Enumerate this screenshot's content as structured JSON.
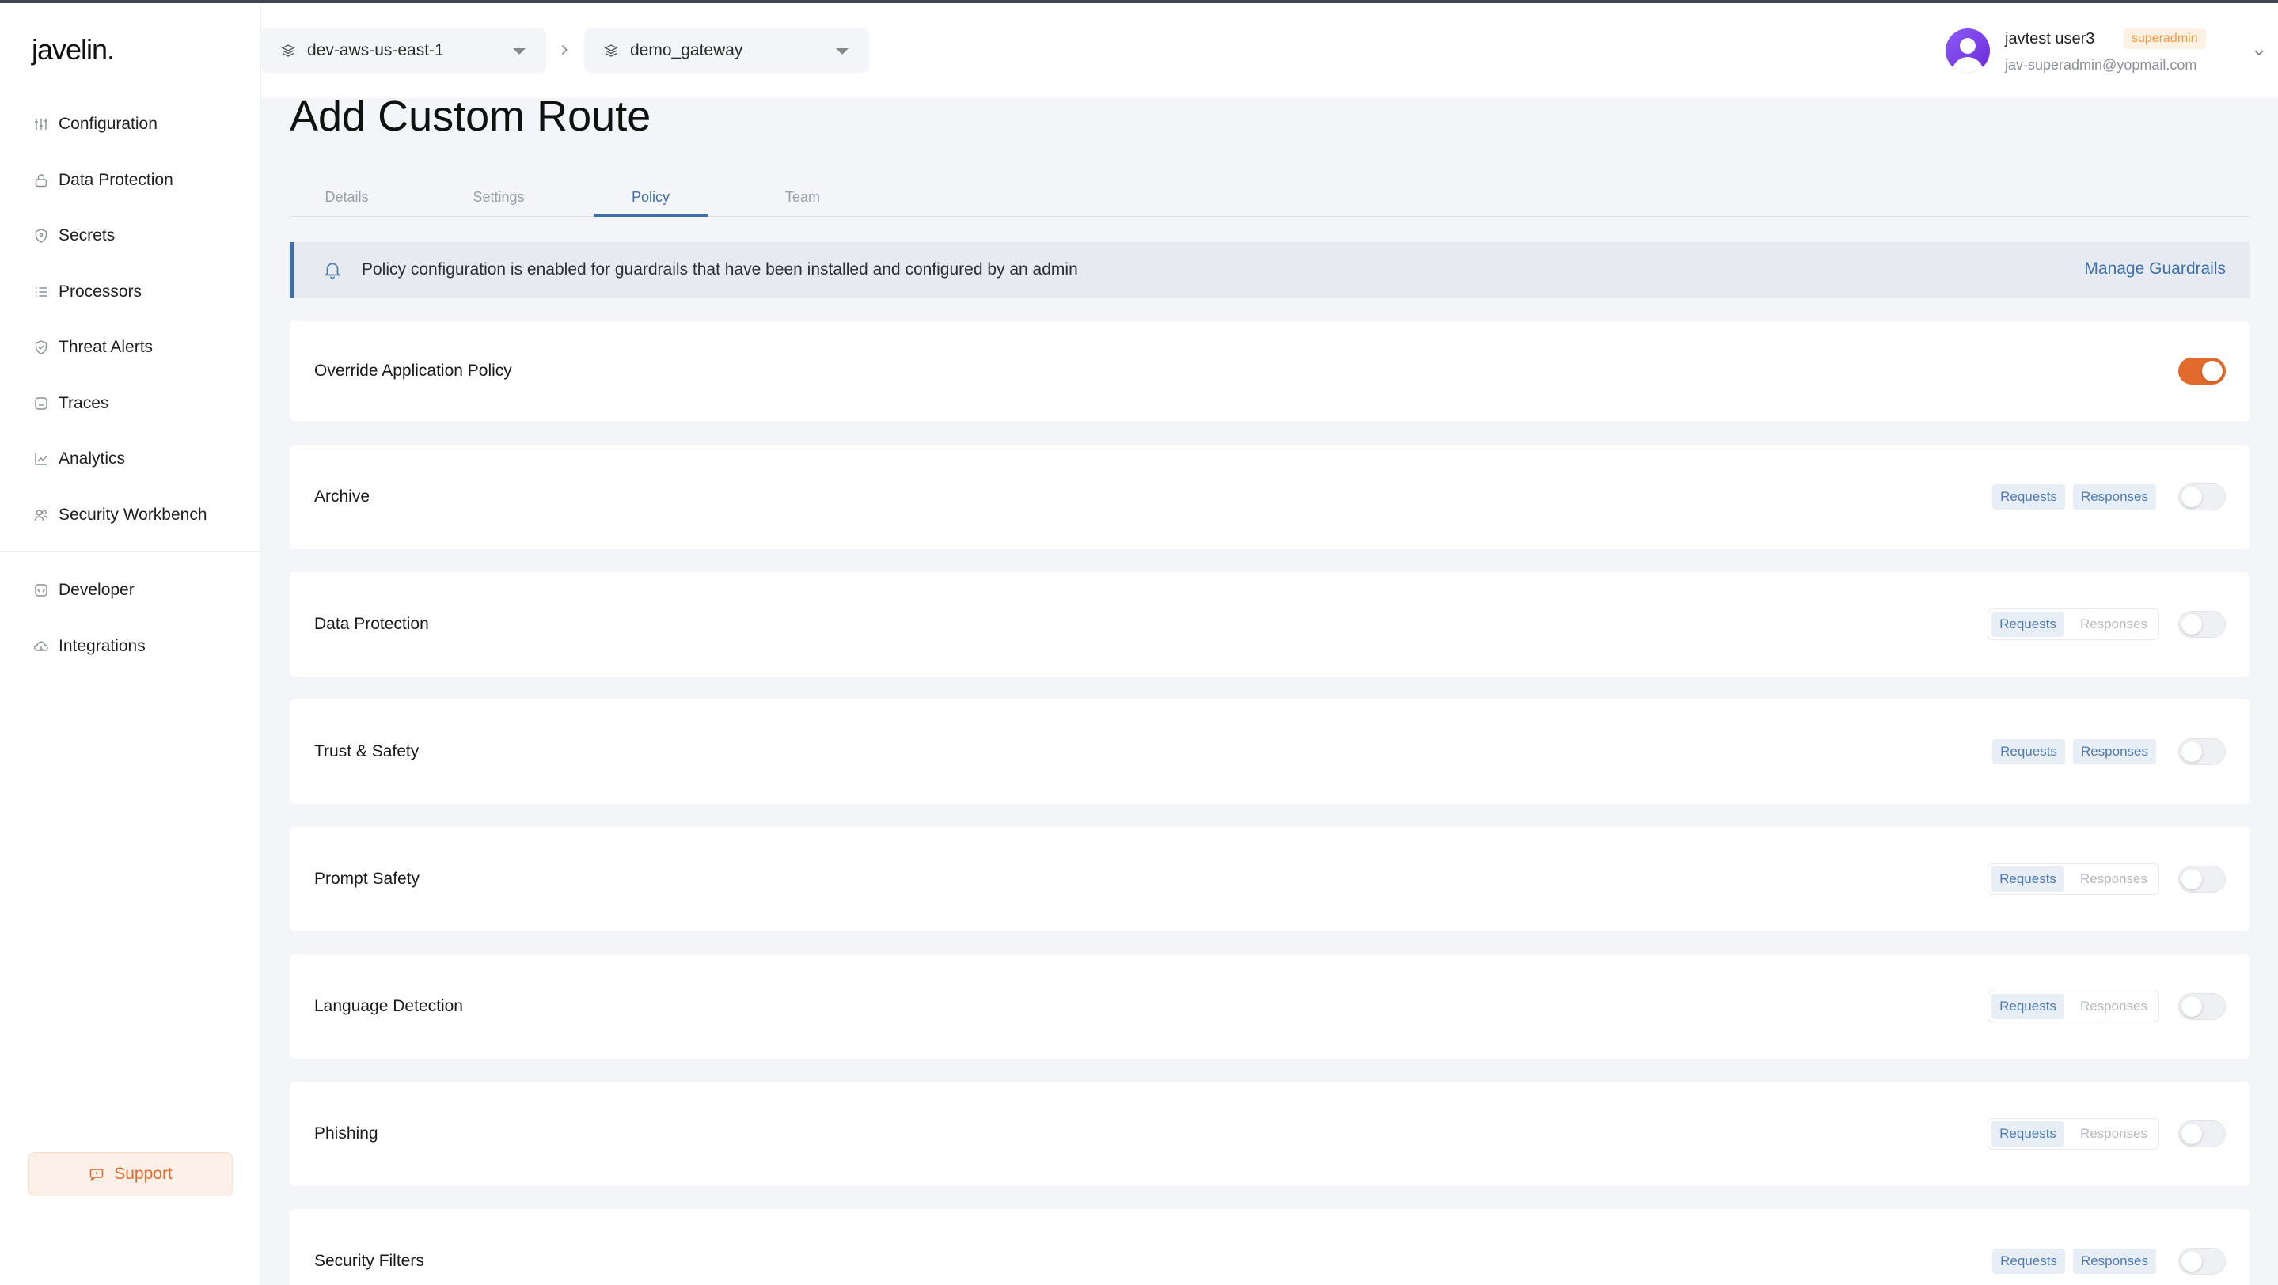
{
  "app": {
    "logo": "javelin."
  },
  "sidebar": {
    "items": [
      {
        "label": "Configuration",
        "icon": "grid-icon"
      },
      {
        "label": "Data Protection",
        "icon": "lock-icon"
      },
      {
        "label": "Secrets",
        "icon": "shield-icon"
      },
      {
        "label": "Processors",
        "icon": "list-icon"
      },
      {
        "label": "Threat Alerts",
        "icon": "shield-check-icon"
      },
      {
        "label": "Traces",
        "icon": "trace-icon"
      },
      {
        "label": "Analytics",
        "icon": "chart-icon"
      },
      {
        "label": "Security Workbench",
        "icon": "users-icon"
      }
    ],
    "secondary": [
      {
        "label": "Developer",
        "icon": "code-icon"
      },
      {
        "label": "Integrations",
        "icon": "cloud-icon"
      }
    ],
    "support_label": "Support"
  },
  "header": {
    "environment": "dev-aws-us-east-1",
    "gateway": "demo_gateway",
    "user": {
      "name": "javtest user3",
      "role": "superadmin",
      "email": "jav-superadmin@yopmail.com"
    }
  },
  "page": {
    "title": "Add Custom Route",
    "tabs": [
      "Details",
      "Settings",
      "Policy",
      "Team"
    ],
    "active_tab": "Policy",
    "banner": {
      "message": "Policy configuration is enabled for guardrails that have been installed and configured by an admin",
      "action": "Manage Guardrails"
    },
    "override": {
      "label": "Override Application Policy",
      "enabled": true
    },
    "policies": [
      {
        "label": "Archive",
        "requests": "Requests",
        "responses": "Responses",
        "responses_active": true,
        "enabled": false
      },
      {
        "label": "Data Protection",
        "requests": "Requests",
        "responses": "Responses",
        "responses_active": false,
        "enabled": false
      },
      {
        "label": "Trust & Safety",
        "requests": "Requests",
        "responses": "Responses",
        "responses_active": true,
        "enabled": false
      },
      {
        "label": "Prompt Safety",
        "requests": "Requests",
        "responses": "Responses",
        "responses_active": false,
        "enabled": false
      },
      {
        "label": "Language Detection",
        "requests": "Requests",
        "responses": "Responses",
        "responses_active": false,
        "enabled": false
      },
      {
        "label": "Phishing",
        "requests": "Requests",
        "responses": "Responses",
        "responses_active": false,
        "enabled": false
      },
      {
        "label": "Security Filters",
        "requests": "Requests",
        "responses": "Responses",
        "responses_active": true,
        "enabled": false
      }
    ]
  },
  "colors": {
    "accent": "#3f6fa8",
    "toggle_on": "#e26a2c",
    "support": "#e0692a",
    "role_badge": "#f39a3b"
  }
}
